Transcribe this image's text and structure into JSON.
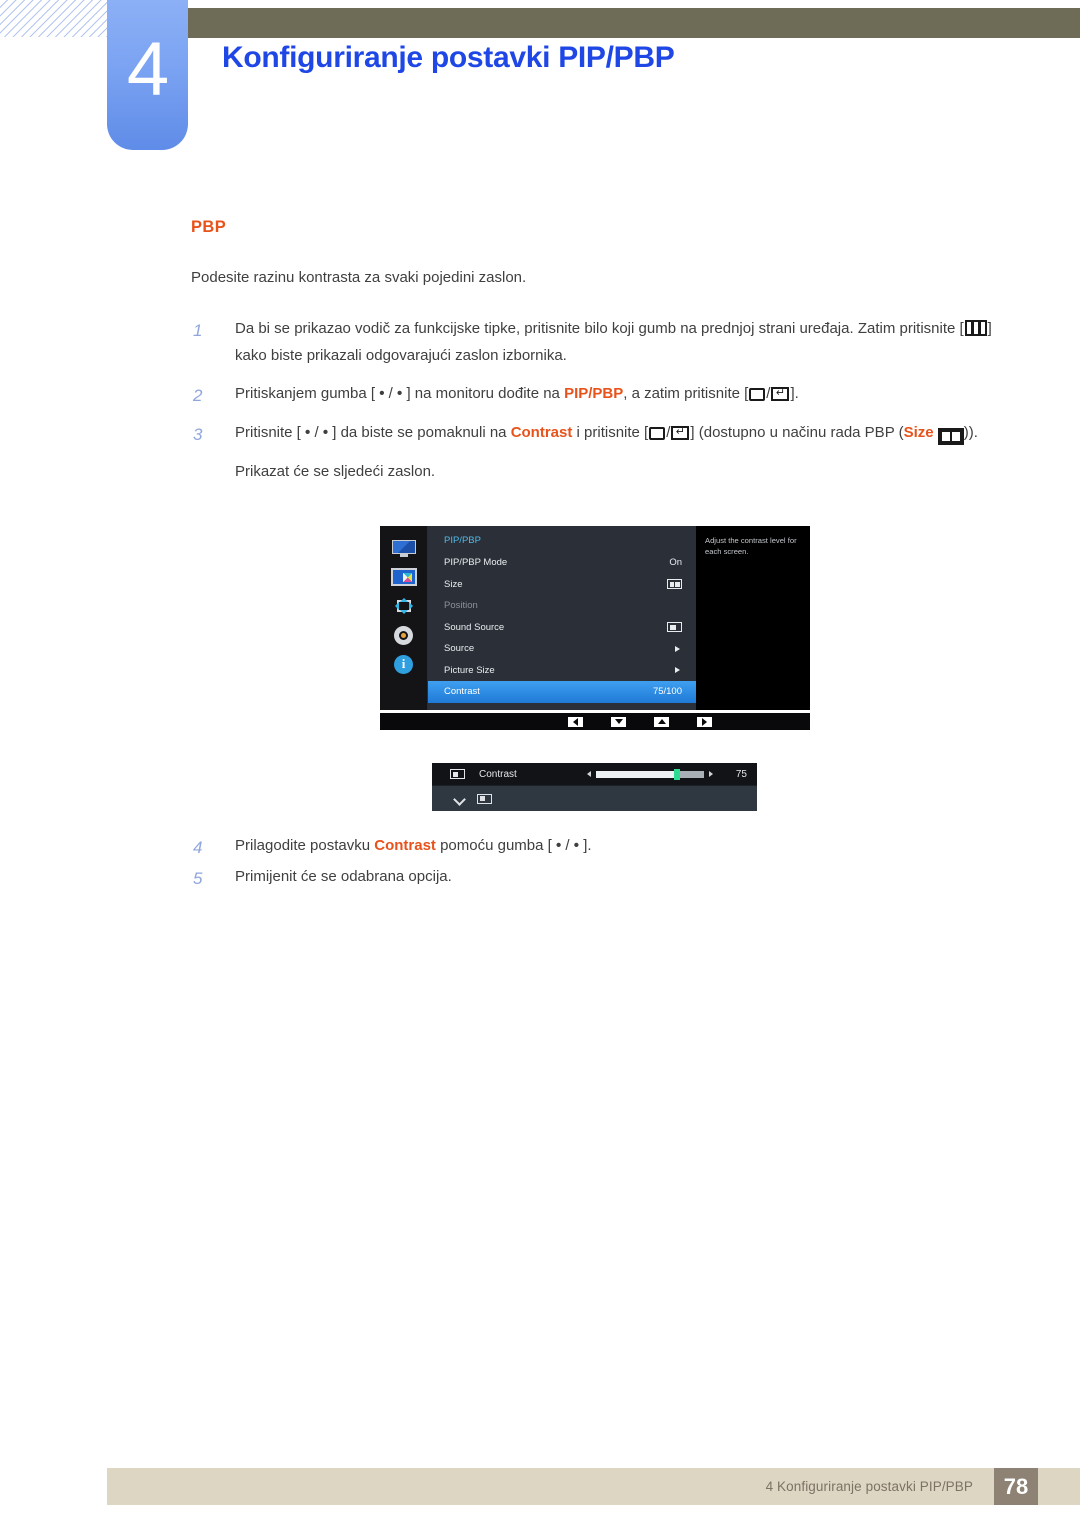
{
  "header": {
    "chapter_number": "4",
    "chapter_title": "Konfiguriranje postavki PIP/PBP"
  },
  "section": {
    "title": "PBP",
    "lead": "Podesite razinu kontrasta za svaki pojedini zaslon."
  },
  "steps": [
    {
      "num": "1",
      "parts": {
        "a": "Da bi se prikazao vodič za funkcijske tipke, pritisnite bilo koji gumb na prednjoj strani uređaja. Zatim pritisnite [",
        "b": "] kako biste prikazali odgovarajući zaslon izbornika."
      }
    },
    {
      "num": "2",
      "parts": {
        "a": "Pritiskanjem gumba [ ",
        "b": " / ",
        "c": " ] na monitoru dođite na ",
        "keyword": "PIP/PBP",
        "d": ", a zatim pritisnite [",
        "e": "/",
        "f": "]."
      }
    },
    {
      "num": "3",
      "parts": {
        "a": "Pritisnite [ ",
        "b": " / ",
        "c": " ] da biste se pomaknuli na ",
        "keyword": "Contrast",
        "d": " i pritisnite [",
        "e": "/",
        "f": "] (dostupno u načinu rada PBP (",
        "keyword2": "Size",
        "g": "))."
      }
    },
    {
      "num": "4",
      "parts": {
        "a": "Prilagodite postavku ",
        "keyword": "Contrast",
        "b": " pomoću gumba [ ",
        "c": " / ",
        "d": " ]."
      }
    },
    {
      "num": "5",
      "parts": {
        "a": "Primijenit će se odabrana opcija."
      }
    }
  ],
  "subnote": "Prikazat će se sljedeći zaslon.",
  "osd": {
    "menu_title": "PIP/PBP",
    "description": "Adjust the contrast level for each screen.",
    "sidebar_icons": [
      "monitor-icon",
      "pip-pbp-icon",
      "position-icon",
      "gear-icon",
      "info-icon"
    ],
    "rows": [
      {
        "label": "PIP/PBP Mode",
        "value": "On",
        "type": "text",
        "state": "normal"
      },
      {
        "label": "Size",
        "value": "",
        "type": "split-box",
        "state": "normal"
      },
      {
        "label": "Position",
        "value": "",
        "type": "none",
        "state": "disabled"
      },
      {
        "label": "Sound Source",
        "value": "",
        "type": "one-box",
        "state": "normal"
      },
      {
        "label": "Source",
        "value": "",
        "type": "arrow",
        "state": "normal"
      },
      {
        "label": "Picture Size",
        "value": "",
        "type": "arrow",
        "state": "normal"
      },
      {
        "label": "Contrast",
        "value": "75/100",
        "type": "text",
        "state": "selected"
      }
    ],
    "nav_buttons": [
      "left-arrow-icon",
      "down-arrow-icon",
      "up-arrow-icon",
      "right-arrow-icon"
    ],
    "slider": {
      "label": "Contrast",
      "value": "75",
      "percent": 75
    },
    "colors": {
      "highlight": "#2f8fe4",
      "menu_title": "#4fb8e8",
      "knob": "#2fdc92"
    }
  },
  "footer": {
    "text": "4 Konfiguriranje postavki PIP/PBP",
    "page": "78"
  },
  "theme": {
    "accent_orange": "#e8531b",
    "title_blue": "#1f47e6",
    "badge_blue": "#7ba3f2",
    "olive": "#6e6c57",
    "footer_band": "#ddd6c3",
    "footer_page": "#8e8274"
  }
}
